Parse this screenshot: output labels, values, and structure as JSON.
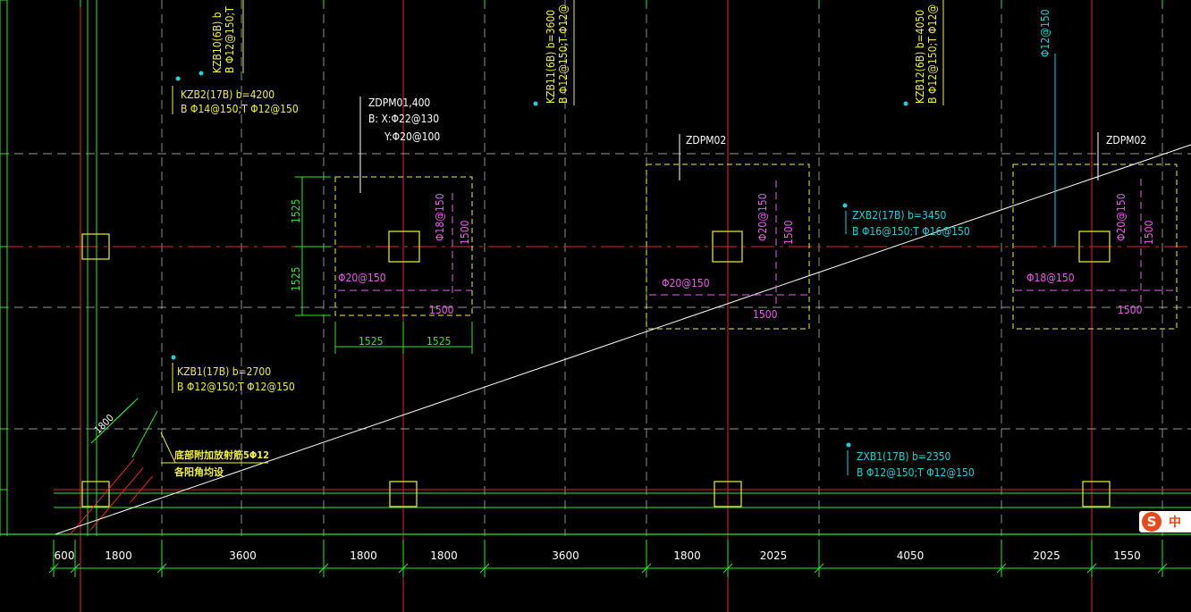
{
  "labels": {
    "kzb10": [
      "KZB10(6B)  b",
      "B Φ12@150;T"
    ],
    "kzb11": [
      "KZB11(6B)  b=3600",
      "B Φ12@150;T Φ12@"
    ],
    "kzb12": [
      "KZB12(6B)  b=4050",
      "B Φ12@150;T Φ12@"
    ],
    "top_right": "Φ12@150",
    "kzb2": [
      "KZB2(17B)  b=4200",
      "B  Φ14@150;T  Φ12@150"
    ],
    "zdpm01": [
      "ZDPM01,400",
      "B: X:Φ22@130",
      "Y:Φ20@100"
    ],
    "zdpm02a": "ZDPM02",
    "zdpm02b": "ZDPM02",
    "zxb2": [
      "ZXB2(17B)  b=3450",
      "B  Φ16@150;T  Φ16@150"
    ],
    "kzb1": [
      "KZB1(17B)  b=2700",
      "B  Φ12@150;T  Φ12@150"
    ],
    "zxb1": [
      "ZXB1(17B)  b=2350",
      "B  Φ12@150;T  Φ12@150"
    ],
    "corner_note": [
      "底部附加放射筋5Φ12",
      "各阳角均设"
    ],
    "corner_dim": "1800"
  },
  "pads": [
    {
      "vertical_rebar": "Φ18@150",
      "horizontal_rebar": "Φ20@150",
      "dim_v": "1500",
      "dim_h": "1500",
      "side_dims": [
        "1525",
        "1525"
      ],
      "bottom_dims": [
        "1525",
        "1525"
      ]
    },
    {
      "vertical_rebar": "Φ20@150",
      "horizontal_rebar": "Φ20@150",
      "dim_v": "1500",
      "dim_h": "1500"
    },
    {
      "vertical_rebar": "Φ20@150",
      "horizontal_rebar": "Φ18@150",
      "dim_v": "1500",
      "dim_h": "1500"
    }
  ],
  "bottom_dimensions": [
    "600",
    "1800",
    "3600",
    "1800",
    "1800",
    "3600",
    "1800",
    "2025",
    "4050",
    "2025",
    "1550"
  ],
  "colors": {
    "background": "#000000",
    "axis_red": "#e8262a",
    "grid_white": "#c8c8c8",
    "green": "#2ee62e",
    "yellow": "#f0f03a",
    "cyan": "#20d0d8",
    "magenta": "#e860e8",
    "white": "#ffffff"
  },
  "ime": {
    "logo": "S",
    "mode": "中"
  }
}
